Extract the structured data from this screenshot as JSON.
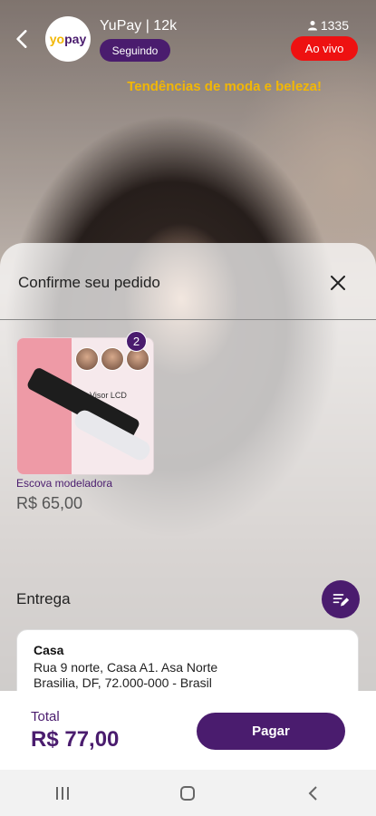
{
  "header": {
    "logo_text_accent": "yo",
    "logo_text_main": "pay",
    "channel_name": "YuPay | 12k",
    "follow_label": "Seguindo",
    "viewer_count": "1335",
    "live_label": "Ao vivo",
    "stream_title": "Tendências de moda e beleza!"
  },
  "order": {
    "title": "Confirme seu pedido",
    "product": {
      "image_caption": "Visor LCD",
      "quantity": "2",
      "name": "Escova modeladora",
      "price": "R$ 65,00"
    },
    "delivery": {
      "title": "Entrega",
      "address_name": "Casa",
      "address_line1": "Rua 9 norte, Casa A1. Asa Norte",
      "address_line2": "Brasilia, DF, 72.000-000 - Brasil"
    }
  },
  "footer": {
    "total_label": "Total",
    "total_value": "R$ 77,00",
    "pay_label": "Pagar"
  },
  "icons": [
    "back-arrow-icon",
    "user-icon",
    "close-icon",
    "edit-list-icon",
    "recent-apps-icon",
    "home-icon",
    "nav-back-icon"
  ],
  "colors": {
    "brand_purple": "#4a1c6e",
    "live_red": "#ee1111",
    "title_yellow": "#f2b705"
  }
}
